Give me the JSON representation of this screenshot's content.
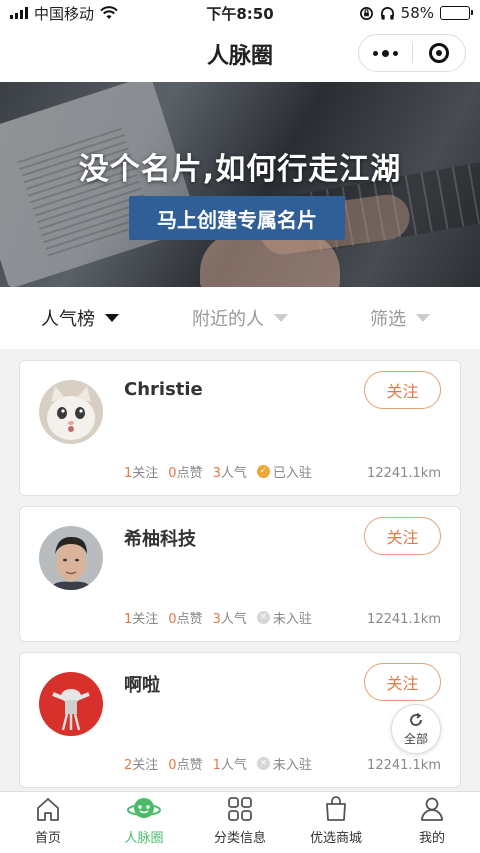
{
  "status": {
    "carrier": "中国移动",
    "time": "下午8:50",
    "battery": "58%",
    "battery_level": 0.58
  },
  "header": {
    "title": "人脉圈"
  },
  "banner": {
    "headline": "没个名片,如何行走江湖",
    "button_label": "马上创建专属名片"
  },
  "filters": [
    {
      "label": "人气榜",
      "active": true
    },
    {
      "label": "附近的人",
      "active": false
    },
    {
      "label": "筛选",
      "active": false
    }
  ],
  "cards": [
    {
      "name": "Christie",
      "follow_label": "关注",
      "following": "1",
      "following_label": "关注",
      "likes": "0",
      "likes_label": "点赞",
      "popularity": "3",
      "popularity_label": "人气",
      "status": "已入驻",
      "status_verified": true,
      "distance": "12241.1km",
      "avatar_icon": "cat-avatar"
    },
    {
      "name": "希柚科技",
      "follow_label": "关注",
      "following": "1",
      "following_label": "关注",
      "likes": "0",
      "likes_label": "点赞",
      "popularity": "3",
      "popularity_label": "人气",
      "status": "未入驻",
      "status_verified": false,
      "distance": "12241.1km",
      "avatar_icon": "man-avatar"
    },
    {
      "name": "啊啦",
      "follow_label": "关注",
      "following": "2",
      "following_label": "关注",
      "likes": "0",
      "likes_label": "点赞",
      "popularity": "1",
      "popularity_label": "人气",
      "status": "未入驻",
      "status_verified": false,
      "distance": "12241.1km",
      "avatar_icon": "figure-avatar"
    }
  ],
  "fab": {
    "label": "全部",
    "icon": "refresh-icon"
  },
  "tabs": [
    {
      "label": "首页",
      "icon": "home-icon",
      "active": false
    },
    {
      "label": "人脉圈",
      "icon": "planet-icon",
      "active": true
    },
    {
      "label": "分类信息",
      "icon": "grid-icon",
      "active": false
    },
    {
      "label": "优选商城",
      "icon": "bag-icon",
      "active": false
    },
    {
      "label": "我的",
      "icon": "user-icon",
      "active": false
    }
  ],
  "colors": {
    "accent_orange": "#e07b47",
    "accent_green": "#4cba6a",
    "banner_button": "#2f5f96",
    "verified_badge": "#f0a632"
  }
}
